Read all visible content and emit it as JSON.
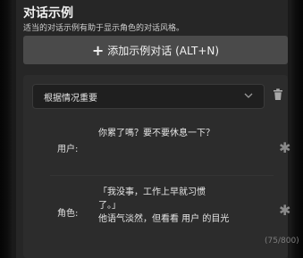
{
  "section": {
    "title": "对话示例",
    "description": "适当的对话示例有助于显示角色的对话风格。"
  },
  "add_button": {
    "label": "添加示例对话 (ALT+N)",
    "icon": "plus-icon"
  },
  "example": {
    "condition_select": {
      "value": "根据情况重要",
      "icon": "chevron-down-icon"
    },
    "delete_icon": "trash-icon",
    "messages": [
      {
        "role": "用户:",
        "lines": [
          "你累了嗎？要不要休息一下？"
        ],
        "icon": "asterisk-icon"
      },
      {
        "role": "角色:",
        "lines": [
          "「我没事，工作上早就习惯",
          "了。」",
          "他语气淡然，但看看 用户 的目光"
        ],
        "icon": "asterisk-icon"
      }
    ],
    "char_count": "(75/800)"
  }
}
